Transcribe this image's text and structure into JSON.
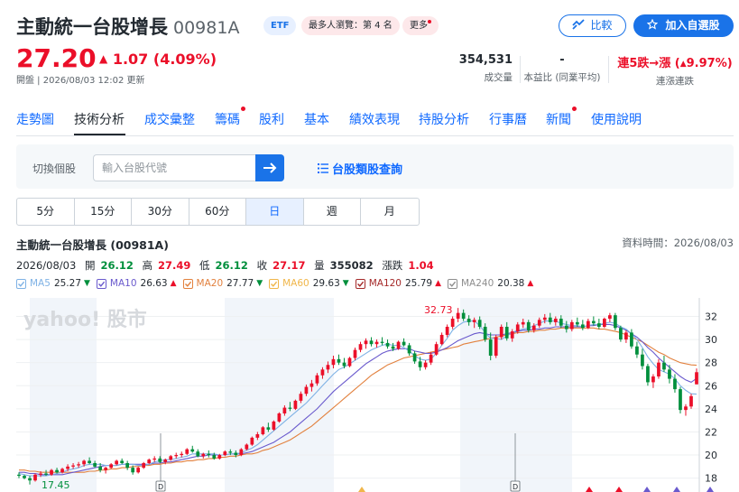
{
  "header": {
    "name": "主動統一台股增長",
    "code": "00981A",
    "etf_tag": "ETF",
    "rank_tag": "最多人瀏覽：第 4 名",
    "more_tag": "更多",
    "compare_label": "比較",
    "watchlist_label": "加入自選股"
  },
  "quote": {
    "price": "27.20",
    "change": "1.07",
    "change_pct": "(4.09%)",
    "status": "開盤 | 2026/08/03 12:02 更新",
    "volume_value": "354,531",
    "volume_label": "成交量",
    "pe_value": "-",
    "pe_label": "本益比 (同業平均)",
    "streak_value": "連5跌→漲 (",
    "streak_pct": "9.97%)",
    "streak_label": "連漲連跌"
  },
  "tabs": [
    {
      "label": "走勢圖",
      "dot": false
    },
    {
      "label": "技術分析",
      "dot": false
    },
    {
      "label": "成交彙整",
      "dot": false
    },
    {
      "label": "籌碼",
      "dot": true
    },
    {
      "label": "股利",
      "dot": false
    },
    {
      "label": "基本",
      "dot": false
    },
    {
      "label": "績效表現",
      "dot": false
    },
    {
      "label": "持股分析",
      "dot": false
    },
    {
      "label": "行事曆",
      "dot": false
    },
    {
      "label": "新聞",
      "dot": true
    },
    {
      "label": "使用說明",
      "dot": false
    }
  ],
  "active_tab": "技術分析",
  "search": {
    "switch_label": "切換個股",
    "placeholder": "輸入台股代號",
    "category_link": "台股類股查詢"
  },
  "periods": [
    "5分",
    "15分",
    "30分",
    "60分",
    "日",
    "週",
    "月"
  ],
  "active_period": "日",
  "chart_info": {
    "title": "主動統一台股增長 (00981A)",
    "data_time": "資料時間：2026/08/03",
    "date": "2026/08/03",
    "open_label": "開",
    "open": "26.12",
    "high_label": "高",
    "high": "27.49",
    "low_label": "低",
    "low": "26.12",
    "close_label": "收",
    "close": "27.17",
    "volume_label": "量",
    "volume": "355082",
    "change_label": "漲跌",
    "change": "1.04"
  },
  "ma": [
    {
      "label": "MA5",
      "value": "25.27",
      "dir": "down",
      "color": "#7fb2e5"
    },
    {
      "label": "MA10",
      "value": "26.63",
      "dir": "up",
      "color": "#6a5acd"
    },
    {
      "label": "MA20",
      "value": "27.77",
      "dir": "down",
      "color": "#e2813e"
    },
    {
      "label": "MA60",
      "value": "29.63",
      "dir": "down",
      "color": "#f0b64a"
    },
    {
      "label": "MA120",
      "value": "25.79",
      "dir": "up",
      "color": "#a52a2a"
    },
    {
      "label": "MA240",
      "value": "20.38",
      "dir": "up",
      "color": "#8e8e8e"
    }
  ],
  "colors": {
    "up": "#eb0f29",
    "down": "#008f3c",
    "accent": "#1a73e8"
  },
  "chart_data": {
    "type": "candlestick",
    "watermark": "yahoo! 股市",
    "yticks": [
      18,
      20,
      22,
      24,
      26,
      28,
      30,
      32
    ],
    "ylim": [
      16.8,
      33.6
    ],
    "max_label": "32.73",
    "min_label": "17.45",
    "event_marker": "D",
    "candles": [
      [
        18.3,
        18.5,
        18.0,
        18.2
      ],
      [
        18.2,
        18.3,
        17.9,
        18.0
      ],
      [
        18.0,
        18.2,
        17.45,
        17.8
      ],
      [
        17.8,
        18.4,
        17.7,
        18.3
      ],
      [
        18.3,
        18.6,
        18.1,
        18.4
      ],
      [
        18.4,
        18.7,
        18.2,
        18.3
      ],
      [
        18.3,
        18.8,
        18.2,
        18.7
      ],
      [
        18.7,
        18.9,
        18.4,
        18.5
      ],
      [
        18.5,
        18.9,
        18.4,
        18.8
      ],
      [
        18.8,
        19.2,
        18.6,
        19.0
      ],
      [
        19.0,
        19.3,
        18.8,
        19.1
      ],
      [
        19.1,
        19.4,
        18.9,
        19.2
      ],
      [
        19.2,
        19.6,
        19.0,
        19.5
      ],
      [
        19.5,
        19.8,
        19.2,
        19.3
      ],
      [
        19.3,
        19.5,
        18.9,
        19.0
      ],
      [
        19.0,
        19.3,
        18.5,
        18.7
      ],
      [
        18.7,
        19.0,
        18.4,
        18.9
      ],
      [
        18.9,
        19.3,
        18.8,
        19.2
      ],
      [
        19.2,
        19.6,
        19.1,
        19.5
      ],
      [
        19.5,
        19.7,
        19.2,
        19.3
      ],
      [
        19.3,
        19.5,
        18.7,
        18.9
      ],
      [
        18.9,
        19.1,
        18.3,
        18.5
      ],
      [
        18.5,
        19.0,
        18.4,
        18.9
      ],
      [
        18.9,
        19.4,
        18.8,
        19.3
      ],
      [
        19.3,
        19.7,
        19.2,
        19.6
      ],
      [
        19.6,
        19.9,
        19.4,
        19.7
      ],
      [
        19.7,
        19.9,
        19.3,
        19.4
      ],
      [
        19.4,
        19.7,
        19.2,
        19.6
      ],
      [
        19.6,
        20.0,
        19.5,
        19.9
      ],
      [
        19.9,
        20.2,
        19.7,
        20.0
      ],
      [
        20.0,
        20.3,
        19.8,
        20.1
      ],
      [
        20.1,
        20.6,
        20.0,
        20.5
      ],
      [
        20.5,
        20.8,
        20.2,
        20.3
      ],
      [
        20.3,
        20.5,
        19.8,
        19.9
      ],
      [
        19.9,
        20.2,
        19.7,
        20.1
      ],
      [
        20.1,
        20.4,
        19.8,
        20.0
      ],
      [
        20.0,
        20.2,
        19.6,
        19.7
      ],
      [
        19.7,
        20.1,
        19.6,
        20.0
      ],
      [
        20.0,
        20.4,
        19.9,
        20.3
      ],
      [
        20.3,
        20.5,
        20.0,
        20.2
      ],
      [
        20.2,
        20.4,
        19.8,
        20.0
      ],
      [
        20.0,
        20.6,
        19.9,
        20.5
      ],
      [
        20.5,
        21.0,
        20.4,
        20.9
      ],
      [
        20.9,
        21.6,
        20.8,
        21.5
      ],
      [
        21.5,
        22.0,
        21.3,
        21.8
      ],
      [
        21.8,
        22.5,
        21.7,
        22.4
      ],
      [
        22.4,
        22.8,
        22.0,
        22.2
      ],
      [
        22.2,
        23.0,
        22.1,
        22.9
      ],
      [
        22.9,
        23.7,
        22.8,
        23.6
      ],
      [
        23.6,
        24.3,
        23.4,
        24.1
      ],
      [
        24.1,
        24.6,
        23.8,
        24.0
      ],
      [
        24.0,
        24.8,
        23.9,
        24.7
      ],
      [
        24.7,
        25.5,
        24.5,
        25.3
      ],
      [
        25.3,
        26.1,
        25.1,
        25.9
      ],
      [
        25.9,
        26.5,
        25.5,
        26.2
      ],
      [
        26.2,
        27.1,
        26.0,
        26.9
      ],
      [
        26.9,
        27.6,
        26.6,
        27.4
      ],
      [
        27.4,
        28.1,
        27.1,
        27.8
      ],
      [
        27.8,
        28.6,
        27.5,
        28.3
      ],
      [
        28.3,
        28.7,
        27.8,
        28.0
      ],
      [
        28.0,
        28.4,
        27.5,
        27.7
      ],
      [
        27.7,
        28.5,
        27.6,
        28.4
      ],
      [
        28.4,
        29.3,
        28.2,
        29.1
      ],
      [
        29.1,
        29.8,
        28.9,
        29.6
      ],
      [
        29.6,
        30.1,
        29.2,
        29.9
      ],
      [
        29.9,
        30.2,
        29.4,
        29.6
      ],
      [
        29.6,
        30.0,
        29.3,
        29.8
      ],
      [
        29.8,
        30.2,
        29.5,
        29.7
      ],
      [
        29.7,
        30.0,
        29.2,
        29.4
      ],
      [
        29.4,
        29.7,
        29.0,
        29.2
      ],
      [
        29.2,
        29.9,
        29.1,
        29.8
      ],
      [
        29.8,
        30.1,
        29.4,
        29.5
      ],
      [
        29.5,
        29.7,
        28.6,
        28.8
      ],
      [
        28.8,
        29.0,
        27.9,
        28.1
      ],
      [
        28.1,
        28.5,
        27.3,
        27.6
      ],
      [
        27.6,
        28.2,
        27.4,
        28.0
      ],
      [
        28.0,
        28.9,
        27.8,
        28.7
      ],
      [
        28.7,
        29.8,
        28.6,
        29.6
      ],
      [
        29.6,
        30.6,
        29.5,
        30.4
      ],
      [
        30.4,
        31.3,
        30.2,
        31.1
      ],
      [
        31.1,
        32.0,
        30.9,
        31.8
      ],
      [
        31.8,
        32.73,
        31.5,
        32.3
      ],
      [
        32.3,
        32.6,
        31.6,
        31.8
      ],
      [
        31.8,
        32.1,
        31.2,
        31.5
      ],
      [
        31.5,
        31.9,
        31.0,
        31.7
      ],
      [
        31.7,
        32.0,
        30.9,
        31.1
      ],
      [
        31.1,
        31.4,
        29.8,
        30.0
      ],
      [
        30.0,
        30.6,
        28.2,
        28.6
      ],
      [
        28.6,
        30.4,
        28.4,
        30.2
      ],
      [
        30.2,
        31.3,
        30.0,
        31.1
      ],
      [
        31.1,
        31.5,
        29.9,
        30.1
      ],
      [
        30.1,
        30.9,
        29.8,
        30.7
      ],
      [
        30.7,
        31.5,
        30.5,
        31.3
      ],
      [
        31.3,
        31.8,
        31.0,
        31.5
      ],
      [
        31.5,
        31.7,
        30.6,
        30.8
      ],
      [
        30.8,
        31.4,
        30.6,
        31.2
      ],
      [
        31.2,
        31.9,
        31.0,
        31.7
      ],
      [
        31.7,
        32.2,
        31.4,
        31.9
      ],
      [
        31.9,
        32.3,
        31.3,
        31.5
      ],
      [
        31.5,
        32.0,
        31.2,
        31.8
      ],
      [
        31.8,
        32.1,
        31.0,
        31.2
      ],
      [
        31.2,
        31.6,
        30.6,
        30.9
      ],
      [
        30.9,
        31.7,
        30.7,
        31.5
      ],
      [
        31.5,
        31.9,
        31.1,
        31.3
      ],
      [
        31.3,
        31.7,
        30.8,
        31.0
      ],
      [
        31.0,
        31.8,
        30.9,
        31.6
      ],
      [
        31.6,
        32.0,
        31.2,
        31.4
      ],
      [
        31.4,
        31.8,
        30.9,
        31.1
      ],
      [
        31.1,
        31.9,
        31.0,
        31.8
      ],
      [
        31.8,
        32.3,
        31.5,
        32.1
      ],
      [
        32.1,
        32.3,
        30.8,
        31.0
      ],
      [
        31.0,
        31.2,
        29.8,
        30.0
      ],
      [
        30.0,
        30.8,
        29.7,
        30.6
      ],
      [
        30.6,
        30.9,
        29.2,
        29.4
      ],
      [
        29.4,
        29.8,
        28.4,
        28.7
      ],
      [
        28.7,
        29.2,
        27.4,
        27.7
      ],
      [
        27.7,
        27.9,
        26.0,
        26.3
      ],
      [
        26.3,
        27.0,
        25.8,
        26.8
      ],
      [
        26.8,
        28.3,
        26.6,
        28.0
      ],
      [
        28.0,
        28.6,
        27.2,
        27.4
      ],
      [
        27.4,
        27.8,
        26.2,
        26.6
      ],
      [
        26.6,
        27.0,
        25.4,
        25.7
      ],
      [
        25.7,
        25.9,
        23.6,
        23.9
      ],
      [
        23.9,
        24.4,
        23.4,
        24.2
      ],
      [
        24.2,
        25.3,
        24.0,
        25.1
      ],
      [
        26.12,
        27.49,
        26.12,
        27.17
      ]
    ],
    "ma5": [
      18.4,
      18.3,
      18.2,
      18.2,
      18.2,
      18.2,
      18.3,
      18.4,
      18.5,
      18.7,
      18.8,
      18.9,
      19.1,
      19.2,
      19.2,
      19.2,
      19.1,
      19.1,
      19.1,
      19.2,
      19.2,
      19.2,
      19.1,
      19.1,
      19.2,
      19.4,
      19.5,
      19.6,
      19.6,
      19.7,
      19.8,
      19.9,
      20.1,
      20.1,
      20.1,
      20.1,
      20.1,
      20.0,
      20.0,
      20.1,
      20.1,
      20.2,
      20.4,
      20.6,
      20.9,
      21.3,
      21.7,
      22.1,
      22.5,
      22.9,
      23.3,
      23.7,
      24.1,
      24.5,
      25.0,
      25.5,
      26.0,
      26.5,
      27.0,
      27.4,
      27.6,
      27.9,
      28.2,
      28.5,
      28.8,
      29.1,
      29.3,
      29.5,
      29.6,
      29.5,
      29.5,
      29.3,
      29.0,
      28.6,
      28.3,
      28.2,
      28.3,
      28.8,
      29.5,
      30.1,
      30.8,
      31.2,
      31.5,
      31.6,
      31.6,
      31.2,
      30.6,
      30.1,
      30.1,
      30.0,
      30.3,
      30.6,
      30.8,
      30.9,
      31.0,
      31.2,
      31.4,
      31.6,
      31.6,
      31.6,
      31.4,
      31.3,
      31.2,
      31.2,
      31.1,
      31.2,
      31.3,
      31.3,
      31.4,
      31.5,
      31.4,
      31.1,
      30.9,
      30.5,
      30.0,
      29.3,
      28.5,
      27.9,
      27.4,
      27.2,
      27.0,
      26.6,
      26.0,
      25.6,
      25.3,
      25.27
    ],
    "ma10": [
      18.5,
      18.5,
      18.4,
      18.4,
      18.3,
      18.3,
      18.3,
      18.3,
      18.3,
      18.4,
      18.5,
      18.6,
      18.7,
      18.8,
      18.9,
      19.0,
      19.1,
      19.1,
      19.1,
      19.2,
      19.2,
      19.2,
      19.2,
      19.2,
      19.2,
      19.3,
      19.3,
      19.4,
      19.4,
      19.5,
      19.6,
      19.7,
      19.8,
      19.9,
      19.9,
      20.0,
      20.0,
      20.0,
      20.0,
      20.1,
      20.1,
      20.1,
      20.2,
      20.3,
      20.5,
      20.7,
      20.9,
      21.1,
      21.4,
      21.7,
      22.0,
      22.4,
      22.8,
      23.2,
      23.6,
      24.0,
      24.5,
      25.0,
      25.5,
      25.9,
      26.3,
      26.7,
      27.1,
      27.5,
      27.9,
      28.2,
      28.5,
      28.8,
      29.0,
      29.1,
      29.2,
      29.2,
      29.2,
      29.0,
      28.9,
      28.8,
      28.8,
      28.9,
      29.1,
      29.3,
      29.6,
      29.9,
      30.1,
      30.3,
      30.5,
      30.6,
      30.5,
      30.4,
      30.4,
      30.4,
      30.5,
      30.6,
      30.7,
      30.8,
      30.8,
      30.9,
      30.9,
      31.0,
      31.0,
      31.1,
      31.1,
      31.1,
      31.1,
      31.1,
      31.1,
      31.2,
      31.2,
      31.3,
      31.3,
      31.3,
      31.2,
      31.0,
      30.8,
      30.5,
      30.2,
      29.8,
      29.3,
      28.9,
      28.4,
      28.0,
      27.6,
      27.2,
      26.8,
      26.5,
      26.3,
      26.63
    ],
    "ma20": [
      18.7,
      18.7,
      18.6,
      18.6,
      18.5,
      18.5,
      18.5,
      18.5,
      18.5,
      18.5,
      18.5,
      18.5,
      18.5,
      18.6,
      18.6,
      18.7,
      18.7,
      18.8,
      18.8,
      18.9,
      18.9,
      19.0,
      19.0,
      19.1,
      19.1,
      19.2,
      19.2,
      19.3,
      19.3,
      19.4,
      19.4,
      19.5,
      19.5,
      19.6,
      19.6,
      19.7,
      19.7,
      19.8,
      19.8,
      19.9,
      19.9,
      20.0,
      20.1,
      20.1,
      20.2,
      20.4,
      20.5,
      20.7,
      20.9,
      21.1,
      21.3,
      21.6,
      21.9,
      22.2,
      22.5,
      22.9,
      23.3,
      23.7,
      24.1,
      24.5,
      24.9,
      25.3,
      25.7,
      26.1,
      26.5,
      26.9,
      27.2,
      27.5,
      27.8,
      28.0,
      28.2,
      28.4,
      28.5,
      28.6,
      28.7,
      28.8,
      28.9,
      29.0,
      29.1,
      29.2,
      29.3,
      29.4,
      29.6,
      29.7,
      29.8,
      29.9,
      30.0,
      30.1,
      30.2,
      30.3,
      30.4,
      30.5,
      30.6,
      30.6,
      30.7,
      30.7,
      30.8,
      30.8,
      30.9,
      30.9,
      31.0,
      31.0,
      31.0,
      31.0,
      31.0,
      31.0,
      31.0,
      30.9,
      30.9,
      30.8,
      30.7,
      30.6,
      30.4,
      30.2,
      30.0,
      29.8,
      29.5,
      29.2,
      28.9,
      28.7,
      28.4,
      28.2,
      28.0,
      27.9,
      27.8,
      27.77
    ]
  }
}
